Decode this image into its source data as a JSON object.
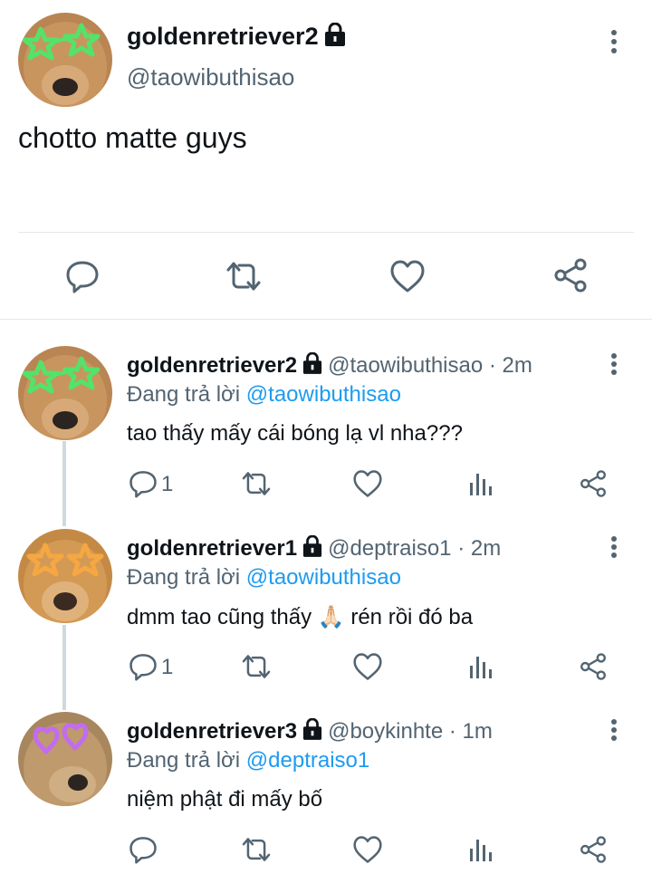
{
  "main_tweet": {
    "name": "goldenretriever2",
    "handle": "@taowibuthisao",
    "text": "chotto matte guys"
  },
  "replies": [
    {
      "name": "goldenretriever2",
      "handle": "@taowibuthisao",
      "time": "· 2m",
      "replying_prefix": "Đang trả lời ",
      "replying_to": "@taowibuthisao",
      "text": "tao thấy mấy cái bóng lạ vl nha???",
      "reply_count": "1",
      "sunglasses_color": "#54e26a"
    },
    {
      "name": "goldenretriever1",
      "handle": "@deptraiso1",
      "time": "· 2m",
      "replying_prefix": "Đang trả lời ",
      "replying_to": "@taowibuthisao",
      "text_before": "dmm tao cũng thấy ",
      "emoji": "🙏🏻",
      "text_after": " rén rồi đó ba",
      "reply_count": "1",
      "sunglasses_color": "#f5a742"
    },
    {
      "name": "goldenretriever3",
      "handle": "@boykinhte",
      "time": "· 1m",
      "replying_prefix": "Đang trả lời ",
      "replying_to": "@deptraiso1",
      "text": "niệm phật đi mấy bố",
      "reply_count": "",
      "sunglasses_color": "#c26cf0"
    }
  ],
  "colors": {
    "accent": "#1d9bf0",
    "secondary_text": "#536471",
    "icon": "#536471"
  },
  "icons": [
    "lock-icon",
    "more-icon",
    "reply-icon",
    "retweet-icon",
    "like-icon",
    "analytics-icon",
    "share-icon"
  ]
}
